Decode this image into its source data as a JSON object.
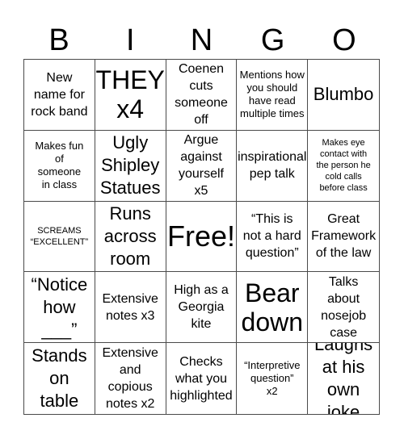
{
  "header": {
    "letters": [
      "B",
      "I",
      "N",
      "G",
      "O"
    ]
  },
  "cells": [
    {
      "text": "New\nname for\nrock band",
      "size": "m"
    },
    {
      "text": "THEY\nx4",
      "size": "xxl"
    },
    {
      "text": "Coenen\ncuts\nsomeone\noff",
      "size": "m"
    },
    {
      "text": "Mentions how\nyou should\nhave read\nmultiple times",
      "size": "s"
    },
    {
      "text": "Blumbo",
      "size": "xl"
    },
    {
      "text": "Makes fun\nof\nsomeone\nin class",
      "size": "s"
    },
    {
      "text": "Ugly\nShipley\nStatues",
      "size": "xl"
    },
    {
      "text": "Argue\nagainst\nyourself\nx5",
      "size": "m"
    },
    {
      "text": "inspirational\npep talk",
      "size": "m"
    },
    {
      "text": "Makes eye\ncontact with\nthe person he\ncold calls\nbefore class",
      "size": "xs"
    },
    {
      "text": "SCREAMS\n“EXCELLENT”",
      "size": "xs"
    },
    {
      "text": "Runs\nacross\nroom",
      "size": "xl"
    },
    {
      "text": "Free!",
      "size": "big"
    },
    {
      "text": "“This is\nnot a hard\nquestion”",
      "size": "m"
    },
    {
      "text": "Great\nFramework\nof the law",
      "size": "m"
    },
    {
      "text": "“Notice\nhow\n___”",
      "size": "xl"
    },
    {
      "text": "Extensive\nnotes x3",
      "size": "m"
    },
    {
      "text": "High as a\nGeorgia\nkite",
      "size": "m"
    },
    {
      "text": "Bear\ndown",
      "size": "xxl"
    },
    {
      "text": "Talks\nabout\nnosejob\ncase",
      "size": "m"
    },
    {
      "text": "Stands\non\ntable",
      "size": "xl"
    },
    {
      "text": "Extensive\nand\ncopious\nnotes x2",
      "size": "m"
    },
    {
      "text": "Checks\nwhat you\nhighlighted",
      "size": "m"
    },
    {
      "text": "“Interpretive\nquestion”\nx2",
      "size": "s"
    },
    {
      "text": "Laughs\nat his\nown joke",
      "size": "xl"
    }
  ]
}
